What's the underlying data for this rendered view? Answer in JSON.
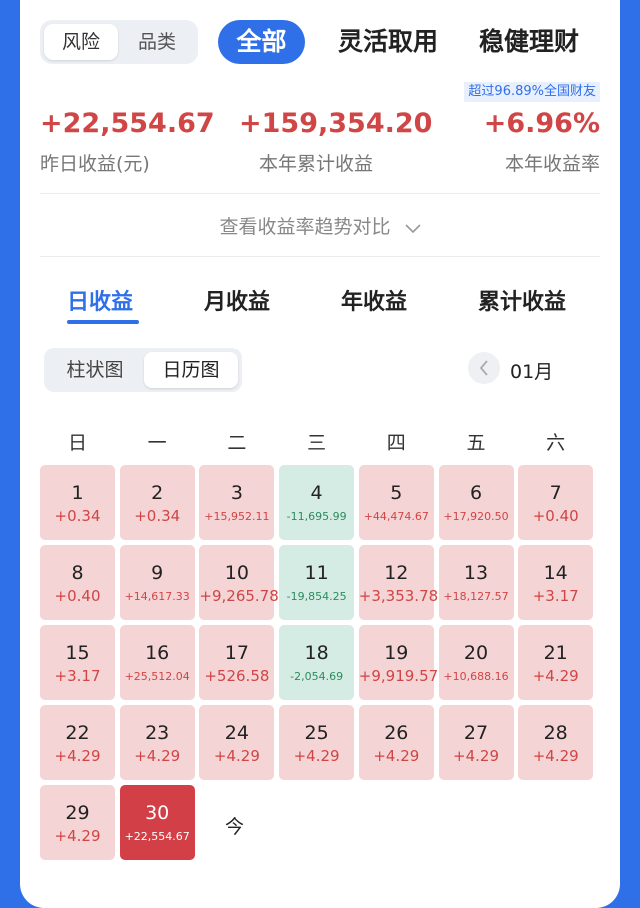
{
  "header": {
    "segment": [
      "风险",
      "品类"
    ],
    "tab_active": "全部",
    "tabs": [
      "灵活取用",
      "稳健理财"
    ]
  },
  "badge": "超过96.89%全国财友",
  "stats": [
    {
      "value": "+22,554.67",
      "label": "昨日收益(元)"
    },
    {
      "value": "+159,354.20",
      "label": "本年累计收益"
    },
    {
      "value": "+6.96%",
      "label": "本年收益率"
    }
  ],
  "trend_link": "查看收益率趋势对比",
  "income_tabs": [
    "日收益",
    "月收益",
    "年收益",
    "累计收益"
  ],
  "view_toggle": [
    "柱状图",
    "日历图"
  ],
  "month": "01月",
  "weekdays": [
    "日",
    "一",
    "二",
    "三",
    "四",
    "五",
    "六"
  ],
  "days": [
    {
      "day": "1",
      "value": "+0.34"
    },
    {
      "day": "2",
      "value": "+0.34"
    },
    {
      "day": "3",
      "value": "+15,952.11"
    },
    {
      "day": "4",
      "value": "-11,695.99"
    },
    {
      "day": "5",
      "value": "+44,474.67"
    },
    {
      "day": "6",
      "value": "+17,920.50"
    },
    {
      "day": "7",
      "value": "+0.40"
    },
    {
      "day": "8",
      "value": "+0.40"
    },
    {
      "day": "9",
      "value": "+14,617.33"
    },
    {
      "day": "10",
      "value": "+9,265.78"
    },
    {
      "day": "11",
      "value": "-19,854.25"
    },
    {
      "day": "12",
      "value": "+3,353.78"
    },
    {
      "day": "13",
      "value": "+18,127.57"
    },
    {
      "day": "14",
      "value": "+3.17"
    },
    {
      "day": "15",
      "value": "+3.17"
    },
    {
      "day": "16",
      "value": "+25,512.04"
    },
    {
      "day": "17",
      "value": "+526.58"
    },
    {
      "day": "18",
      "value": "-2,054.69"
    },
    {
      "day": "19",
      "value": "+9,919.57"
    },
    {
      "day": "20",
      "value": "+10,688.16"
    },
    {
      "day": "21",
      "value": "+4.29"
    },
    {
      "day": "22",
      "value": "+4.29"
    },
    {
      "day": "23",
      "value": "+4.29"
    },
    {
      "day": "24",
      "value": "+4.29"
    },
    {
      "day": "25",
      "value": "+4.29"
    },
    {
      "day": "26",
      "value": "+4.29"
    },
    {
      "day": "27",
      "value": "+4.29"
    },
    {
      "day": "28",
      "value": "+4.29"
    },
    {
      "day": "29",
      "value": "+4.29"
    },
    {
      "day": "30",
      "value": "+22,554.67"
    }
  ],
  "today_label": "今",
  "colors": {
    "accent": "#2f6fe8",
    "positive_bg": "#f5d4d6",
    "negative_bg": "#d4ece3",
    "today_bg": "#d23f46",
    "positive_text": "#d04545",
    "negative_text": "#2e8b5e"
  }
}
